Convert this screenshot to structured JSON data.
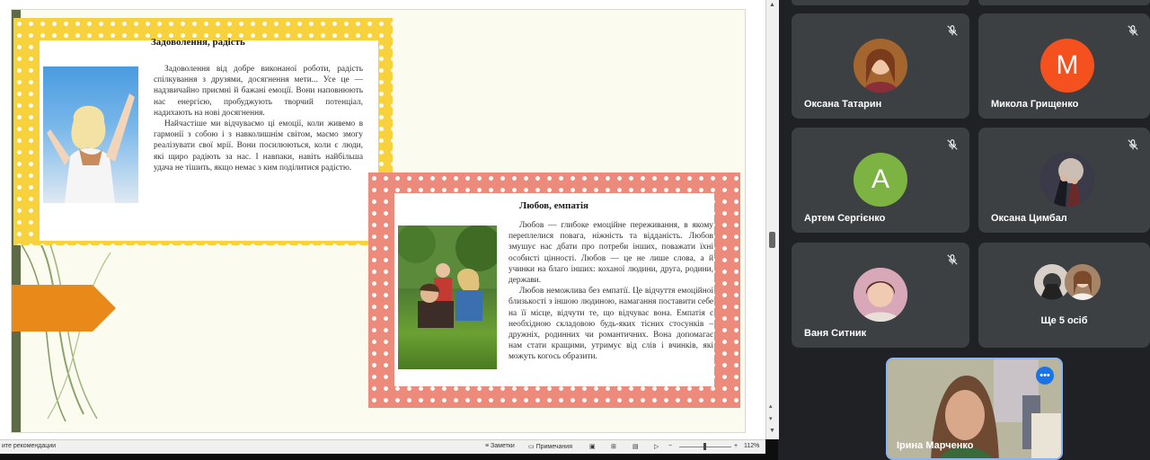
{
  "slide": {
    "card1": {
      "title": "Задоволення, радість",
      "paragraphs": [
        "Задоволення від добре виконаної роботи, радість спілкування з друзями, досягнення мети... Усе це — надзвичайно приємні й бажані емоції. Вони наповнюють нас енергією, пробуджують творчий потенціал, надихають на нові досягнення.",
        "Найчастіше ми відчуваємо ці емоції, коли живемо в гармонії з собою і з навколишнім світом, маємо змогу реалізувати свої мрії. Вони посилюються, коли є люди, які щиро радіють за нас. І навпаки, навіть найбільша удача не тішить, якщо немає з ким поділитися радістю."
      ]
    },
    "card2": {
      "title": "Любов, емпатія",
      "paragraphs": [
        "Любов — глибоке емоційне переживання, в якому переплелися повага, ніжність та відданість. Любов змушує нас дбати про потреби інших, поважати їхні особисті цінності. Любов — це не лише слова, а й учинки на благо інших: коханої людини, друга, родини, держави.",
        "Любов неможлива без емпатії. Це відчуття емоційної близькості з іншою людиною, намагання поставити себе на її місце, відчути те, що відчуває вона. Емпатія є необхідною складовою будь-яких тісних стосунків – дружніх, родинних чи романтичних. Вона допомагає нам стати кращими, утримує від слів і вчинків, які можуть когось образити."
      ]
    }
  },
  "statusbar": {
    "left_text": "ите рекомендации",
    "notes_label": "Заметки",
    "comments_label": "Примечания",
    "zoom": "112%"
  },
  "participants": [
    {
      "name": "Оксана Татарин",
      "avatar_type": "photo",
      "muted": true
    },
    {
      "name": "Микола Грищенко",
      "avatar_type": "letter",
      "letter": "M",
      "color": "#f4511e",
      "muted": true
    },
    {
      "name": "Артем Сергієнко",
      "avatar_type": "letter",
      "letter": "A",
      "color": "#7cb342",
      "muted": true
    },
    {
      "name": "Оксана Цимбал",
      "avatar_type": "photo",
      "muted": true
    },
    {
      "name": "Ваня Ситник",
      "avatar_type": "photo",
      "muted": true
    },
    {
      "name": "Ще 5 осіб",
      "avatar_type": "group"
    },
    {
      "name": "Ірина Марченко",
      "avatar_type": "video",
      "self": true
    }
  ],
  "icons": [
    "mic-off-icon",
    "more-options-icon"
  ]
}
